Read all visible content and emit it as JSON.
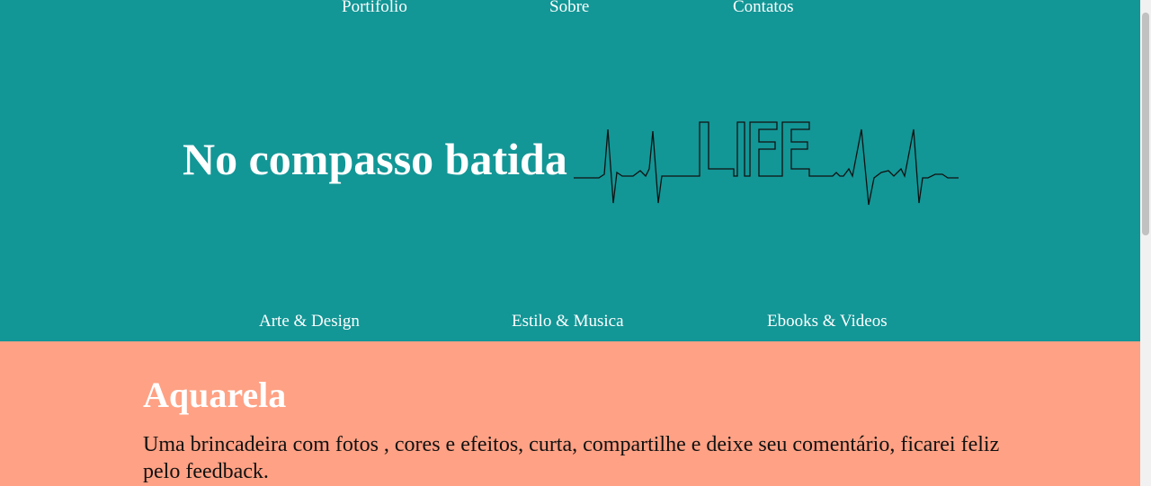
{
  "top_nav": {
    "portfolio": "Portifolio",
    "about": "Sobre",
    "contacts": "Contatos"
  },
  "hero": {
    "title": "No compasso batida",
    "graphic_word": "LIFE"
  },
  "category_nav": {
    "art": "Arte & Design",
    "style": "Estilo & Musica",
    "ebooks": "Ebooks & Videos"
  },
  "article": {
    "title": "Aquarela",
    "body": "Uma brincadeira com fotos , cores e efeitos, curta, compartilhe e deixe seu comentário, ficarei feliz pelo feedback."
  },
  "colors": {
    "hero_bg": "#139696",
    "content_bg": "#ffa184"
  },
  "icons": {
    "heartbeat": "heartbeat-life-icon"
  }
}
